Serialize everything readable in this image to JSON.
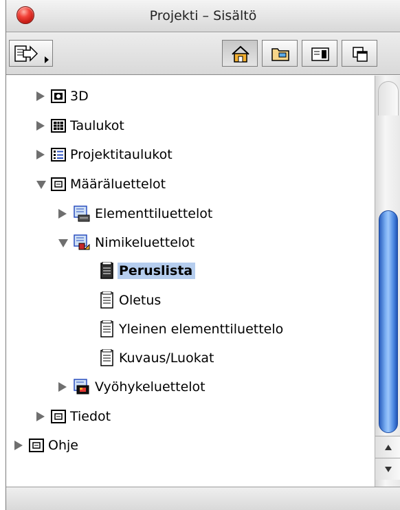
{
  "window": {
    "title": "Projekti – Sisältö"
  },
  "toolbar": {
    "buttons": [
      {
        "name": "export-menu",
        "icon": "export-arrow-icon"
      },
      {
        "name": "project-view",
        "icon": "house-icon",
        "active": true
      },
      {
        "name": "layouts-view",
        "icon": "folder-icon"
      },
      {
        "name": "book-view",
        "icon": "panel-icon"
      },
      {
        "name": "publisher-view",
        "icon": "stacked-windows-icon"
      }
    ]
  },
  "tree": {
    "items": [
      {
        "label": "3D",
        "icon": "3d-icon",
        "expanded": false
      },
      {
        "label": "Taulukot",
        "icon": "table-icon",
        "expanded": false
      },
      {
        "label": "Projektitaulukot",
        "icon": "list-table-icon",
        "expanded": false
      },
      {
        "label": "Määräluettelot",
        "icon": "folder-box-icon",
        "expanded": true
      },
      {
        "label": "Elementtiluettelot",
        "icon": "element-schedule-icon",
        "expanded": false
      },
      {
        "label": "Nimikeluettelot",
        "icon": "component-schedule-icon",
        "expanded": true
      },
      {
        "label": "Peruslista",
        "icon": "document-icon",
        "selected": true
      },
      {
        "label": "Oletus",
        "icon": "document-icon"
      },
      {
        "label": "Yleinen elementtiluettelo",
        "icon": "document-icon"
      },
      {
        "label": "Kuvaus/Luokat",
        "icon": "document-icon"
      },
      {
        "label": "Vyöhykeluettelot",
        "icon": "zone-schedule-icon",
        "expanded": false
      },
      {
        "label": "Tiedot",
        "icon": "folder-box-icon",
        "expanded": false
      },
      {
        "label": "Ohje",
        "icon": "folder-box-icon",
        "expanded": false
      }
    ]
  },
  "colors": {
    "selection": "#b5cdee",
    "scroll_thumb": "#4a86e0",
    "close_button": "#e2322a"
  }
}
